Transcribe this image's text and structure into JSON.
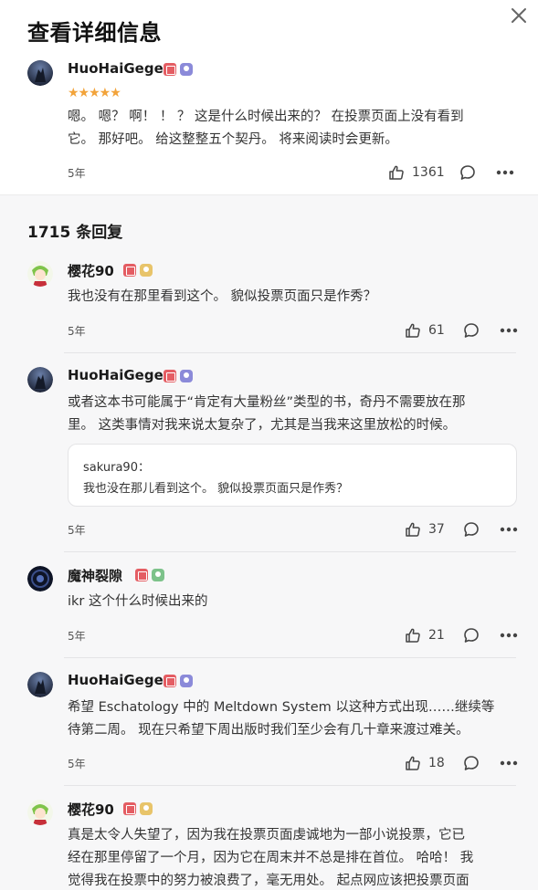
{
  "header": {
    "title": "查看详细信息"
  },
  "top_review": {
    "username": "HuoHaiGege",
    "stars": "★★★★★",
    "lines": [
      "嗯。 嗯？ 啊！ ！ ？ 这是什么时候出来的？ 在投票页面上没有看到",
      "它。 那好吧。 给这整整五个契丹。 将来阅读时会更新。"
    ],
    "time": "5年",
    "likes": "1361"
  },
  "replies_header": "1715 条回复",
  "replies": [
    {
      "username": "樱花90",
      "lines": [
        "我也没有在那里看到这个。 貌似投票页面只是作秀？"
      ],
      "time": "5年",
      "likes": "61"
    },
    {
      "username": "HuoHaiGege",
      "lines": [
        "或者这本书可能属于“肯定有大量粉丝”类型的书，奇丹不需要放在那",
        "里。 这类事情对我来说太复杂了，尤其是当我来这里放松的时候。"
      ],
      "quote": {
        "author": "sakura90：",
        "text": "我也没在那儿看到这个。 貌似投票页面只是作秀？"
      },
      "time": "5年",
      "likes": "37"
    },
    {
      "username": "魔神裂隙",
      "lines": [
        "ikr 这个什么时候出来的"
      ],
      "time": "5年",
      "likes": "21"
    },
    {
      "username": "HuoHaiGege",
      "lines": [
        "希望 Eschatology 中的 Meltdown System 以这种方式出现……继续等",
        "待第二周。 现在只希望下周出版时我们至少会有几十章来渡过难关。"
      ],
      "time": "5年",
      "likes": "18"
    },
    {
      "username": "樱花90",
      "lines": [
        "真是太令人失望了，因为我在投票页面虔诚地为一部小说投票，它已",
        "经在那里停留了一个月，因为它在周末并不总是排在首位。 哈哈！ 我",
        "觉得我在投票中的努力被浪费了，毫无用处。 起点网应该把投票页面"
      ]
    }
  ],
  "colors": {
    "star": "#f2a33a",
    "badge_red": "#e45d63",
    "badge_purple": "#8b8ad9"
  },
  "icons": {
    "close": "close-icon",
    "like": "thumbs-up-icon",
    "comment": "comment-icon",
    "more": "more-icon"
  }
}
